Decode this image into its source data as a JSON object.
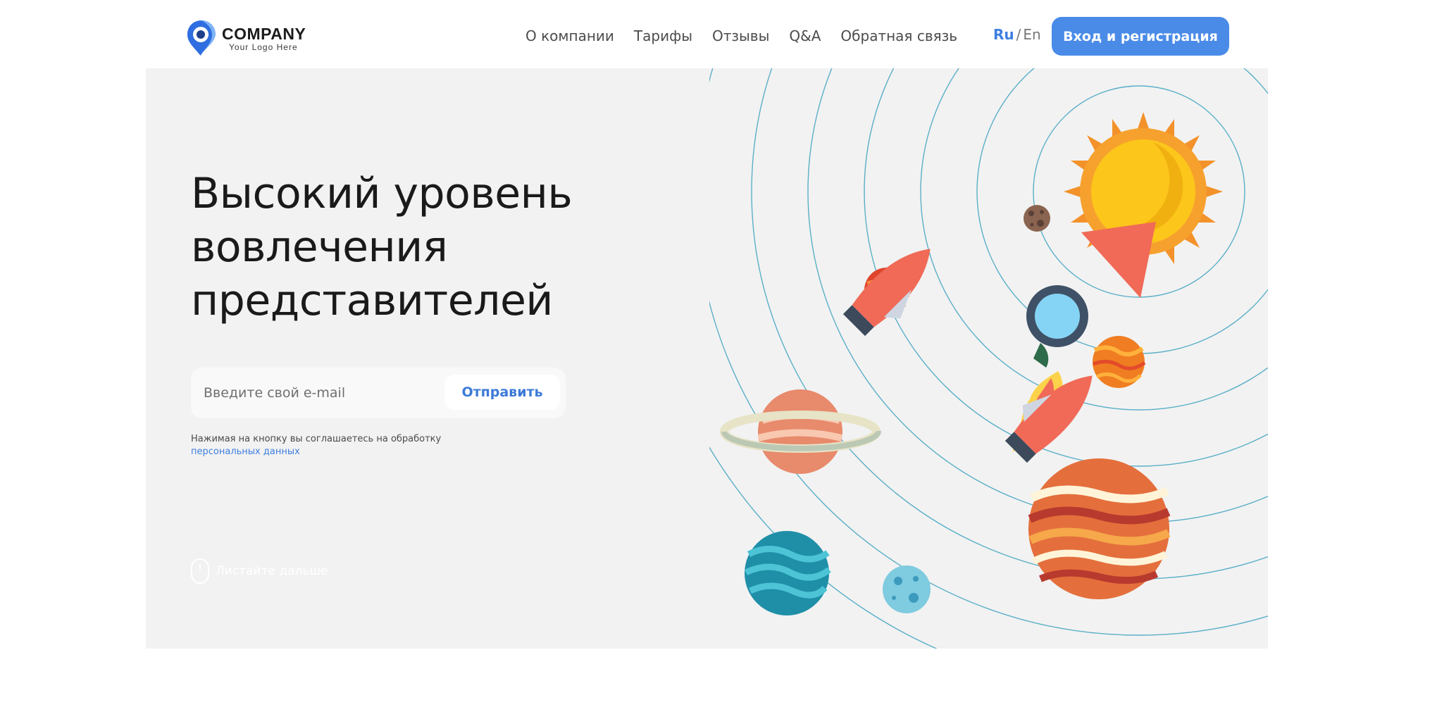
{
  "header": {
    "logo": {
      "title": "COMPANY",
      "subtitle": "Your Logo Here"
    },
    "nav": [
      {
        "label": "О компании"
      },
      {
        "label": "Тарифы"
      },
      {
        "label": "Отзывы"
      },
      {
        "label": "Q&A"
      },
      {
        "label": "Обратная связь"
      }
    ],
    "lang": {
      "ru": "Ru",
      "separator": "/",
      "en": "En",
      "active": "Ru"
    },
    "login_button": "Вход и регистрация"
  },
  "hero": {
    "title_lines": [
      "Высокий уровень",
      "вовлечения",
      "представителей"
    ],
    "email_form": {
      "placeholder": "Введите свой e-mail",
      "value": "",
      "submit_label": "Отправить"
    },
    "consent_text": "Нажимая на кнопку вы соглашаетесь на обработку",
    "consent_link": "персональных данных",
    "scroll_hint": "Листайте дальше"
  },
  "colors": {
    "accent": "#4a8be8",
    "link": "#3f7fe0",
    "hero_background": "#f2f2f2",
    "orbit_lines": "#5aafc8"
  },
  "icons": {
    "logo": "location-pin-icon",
    "scroll": "mouse-icon"
  }
}
